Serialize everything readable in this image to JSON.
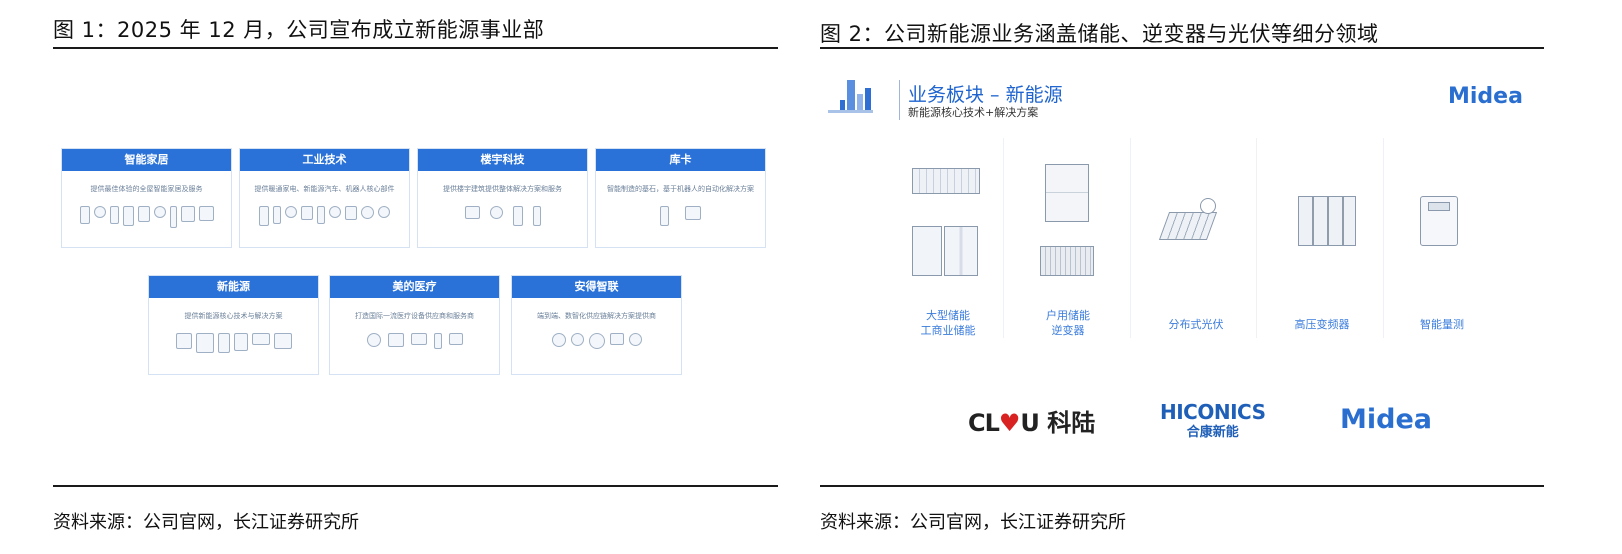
{
  "figure1": {
    "title": "图 1：2025 年 12 月，公司宣布成立新能源事业部",
    "source": "资料来源：公司官网，长江证券研究所",
    "cards": [
      {
        "title": "智能家居",
        "desc": "提供最佳体验的全屋智能家居及服务"
      },
      {
        "title": "工业技术",
        "desc": "提供暖通家电、新能源汽车、机器人核心部件"
      },
      {
        "title": "楼宇科技",
        "desc": "提供楼宇建筑提供整体解决方案和服务"
      },
      {
        "title": "库卡",
        "desc": "智能制造的基石，基于机器人的自动化解决方案"
      },
      {
        "title": "新能源",
        "desc": "提供新能源核心技术与解决方案"
      },
      {
        "title": "美的医疗",
        "desc": "打造国际一流医疗设备供应商和服务商"
      },
      {
        "title": "安得智联",
        "desc": "端到端、数智化供应链解决方案提供商"
      }
    ]
  },
  "figure2": {
    "title": "图 2：公司新能源业务涵盖储能、逆变器与光伏等细分领域",
    "source": "资料来源：公司官网，长江证券研究所",
    "section_title": "业务板块 – 新能源",
    "section_subtitle": "新能源核心技术+解决方案",
    "brand": "Midea",
    "products": [
      {
        "line1": "大型储能",
        "line2": "工商业储能"
      },
      {
        "line1": "户用储能",
        "line2": "逆变器"
      },
      {
        "line1": "分布式光伏",
        "line2": ""
      },
      {
        "line1": "高压变频器",
        "line2": ""
      },
      {
        "line1": "智能量测",
        "line2": ""
      }
    ],
    "logos": {
      "kelu_latin": "CL",
      "kelu_heart": "♥",
      "kelu_u": "U",
      "kelu_cn": "科陆",
      "hiconics_en": "HICONICS",
      "hiconics_cn": "合康新能",
      "midea": "Midea"
    }
  },
  "colors": {
    "card_header": "#2a72d8",
    "brand_blue": "#2a6fd0",
    "label_blue": "#3a7cdc"
  }
}
